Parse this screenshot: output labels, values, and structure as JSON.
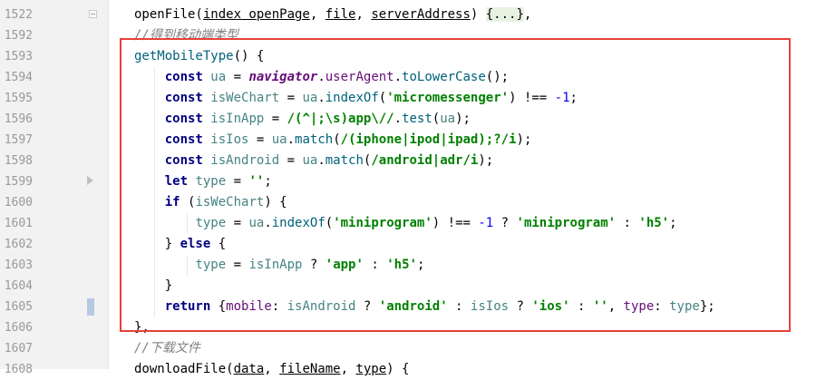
{
  "editor": {
    "lines": [
      {
        "num": "1522",
        "fold": "box",
        "tokens": [
          {
            "t": "openFile(",
            "c": "plain"
          },
          {
            "t": "index openPage",
            "c": "ul"
          },
          {
            "t": ", ",
            "c": "plain"
          },
          {
            "t": "file",
            "c": "ul"
          },
          {
            "t": ", ",
            "c": "plain"
          },
          {
            "t": "serverAddress",
            "c": "ul"
          },
          {
            "t": ") ",
            "c": "plain"
          },
          {
            "t": "{...}",
            "c": "folded"
          },
          {
            "t": ",",
            "c": "plain"
          }
        ]
      },
      {
        "num": "1592",
        "fold": "",
        "tokens": [
          {
            "t": "//得到移动端类型",
            "c": "comment"
          }
        ]
      },
      {
        "num": "1593",
        "fold": "",
        "tokens": [
          {
            "t": "getMobileType",
            "c": "fn"
          },
          {
            "t": "() {",
            "c": "plain"
          }
        ]
      },
      {
        "num": "1594",
        "fold": "",
        "tokens": [
          {
            "t": "    ",
            "c": "plain"
          },
          {
            "t": "const ",
            "c": "kw"
          },
          {
            "t": "ua",
            "c": "ident"
          },
          {
            "t": " = ",
            "c": "plain"
          },
          {
            "t": "navigator",
            "c": "glob"
          },
          {
            "t": ".",
            "c": "plain"
          },
          {
            "t": "userAgent",
            "c": "prop"
          },
          {
            "t": ".",
            "c": "plain"
          },
          {
            "t": "toLowerCase",
            "c": "fn"
          },
          {
            "t": "();",
            "c": "plain"
          }
        ]
      },
      {
        "num": "1595",
        "fold": "",
        "tokens": [
          {
            "t": "    ",
            "c": "plain"
          },
          {
            "t": "const ",
            "c": "kw"
          },
          {
            "t": "isWeChart",
            "c": "ident"
          },
          {
            "t": " = ",
            "c": "plain"
          },
          {
            "t": "ua",
            "c": "ident"
          },
          {
            "t": ".",
            "c": "plain"
          },
          {
            "t": "indexOf",
            "c": "fn"
          },
          {
            "t": "(",
            "c": "plain"
          },
          {
            "t": "'micromessenger'",
            "c": "str"
          },
          {
            "t": ") !== ",
            "c": "plain"
          },
          {
            "t": "-1",
            "c": "num"
          },
          {
            "t": ";",
            "c": "plain"
          }
        ]
      },
      {
        "num": "1596",
        "fold": "",
        "tokens": [
          {
            "t": "    ",
            "c": "plain"
          },
          {
            "t": "const ",
            "c": "kw"
          },
          {
            "t": "isInApp",
            "c": "ident"
          },
          {
            "t": " = ",
            "c": "plain"
          },
          {
            "t": "/(^|;\\s)app\\//",
            "c": "regex"
          },
          {
            "t": ".",
            "c": "plain"
          },
          {
            "t": "test",
            "c": "fn"
          },
          {
            "t": "(",
            "c": "plain"
          },
          {
            "t": "ua",
            "c": "ident"
          },
          {
            "t": ");",
            "c": "plain"
          }
        ]
      },
      {
        "num": "1597",
        "fold": "",
        "tokens": [
          {
            "t": "    ",
            "c": "plain"
          },
          {
            "t": "const ",
            "c": "kw"
          },
          {
            "t": "isIos",
            "c": "ident"
          },
          {
            "t": " = ",
            "c": "plain"
          },
          {
            "t": "ua",
            "c": "ident"
          },
          {
            "t": ".",
            "c": "plain"
          },
          {
            "t": "match",
            "c": "fn"
          },
          {
            "t": "(",
            "c": "plain"
          },
          {
            "t": "/(iphone|ipod|ipad);?/i",
            "c": "regex"
          },
          {
            "t": ");",
            "c": "plain"
          }
        ]
      },
      {
        "num": "1598",
        "fold": "",
        "tokens": [
          {
            "t": "    ",
            "c": "plain"
          },
          {
            "t": "const ",
            "c": "kw"
          },
          {
            "t": "isAndroid",
            "c": "ident"
          },
          {
            "t": " = ",
            "c": "plain"
          },
          {
            "t": "ua",
            "c": "ident"
          },
          {
            "t": ".",
            "c": "plain"
          },
          {
            "t": "match",
            "c": "fn"
          },
          {
            "t": "(",
            "c": "plain"
          },
          {
            "t": "/android|adr/i",
            "c": "regex"
          },
          {
            "t": ");",
            "c": "plain"
          }
        ]
      },
      {
        "num": "1599",
        "fold": "arrow",
        "tokens": [
          {
            "t": "    ",
            "c": "plain"
          },
          {
            "t": "let ",
            "c": "kw"
          },
          {
            "t": "type",
            "c": "ident"
          },
          {
            "t": " = ",
            "c": "plain"
          },
          {
            "t": "''",
            "c": "str"
          },
          {
            "t": ";",
            "c": "plain"
          }
        ]
      },
      {
        "num": "1600",
        "fold": "",
        "tokens": [
          {
            "t": "    ",
            "c": "plain"
          },
          {
            "t": "if ",
            "c": "kw"
          },
          {
            "t": "(",
            "c": "plain"
          },
          {
            "t": "isWeChart",
            "c": "ident"
          },
          {
            "t": ") {",
            "c": "plain"
          }
        ]
      },
      {
        "num": "1601",
        "fold": "",
        "tokens": [
          {
            "t": "        ",
            "c": "plain"
          },
          {
            "t": "type",
            "c": "ident"
          },
          {
            "t": " = ",
            "c": "plain"
          },
          {
            "t": "ua",
            "c": "ident"
          },
          {
            "t": ".",
            "c": "plain"
          },
          {
            "t": "indexOf",
            "c": "fn"
          },
          {
            "t": "(",
            "c": "plain"
          },
          {
            "t": "'miniprogram'",
            "c": "str"
          },
          {
            "t": ") !== ",
            "c": "plain"
          },
          {
            "t": "-1",
            "c": "num"
          },
          {
            "t": " ? ",
            "c": "plain"
          },
          {
            "t": "'miniprogram'",
            "c": "str"
          },
          {
            "t": " : ",
            "c": "plain"
          },
          {
            "t": "'h5'",
            "c": "str"
          },
          {
            "t": ";",
            "c": "plain"
          }
        ]
      },
      {
        "num": "1602",
        "fold": "",
        "tokens": [
          {
            "t": "    } ",
            "c": "plain"
          },
          {
            "t": "else ",
            "c": "kw"
          },
          {
            "t": "{",
            "c": "plain"
          }
        ]
      },
      {
        "num": "1603",
        "fold": "",
        "tokens": [
          {
            "t": "        ",
            "c": "plain"
          },
          {
            "t": "type",
            "c": "ident"
          },
          {
            "t": " = ",
            "c": "plain"
          },
          {
            "t": "isInApp",
            "c": "ident"
          },
          {
            "t": " ? ",
            "c": "plain"
          },
          {
            "t": "'app'",
            "c": "str"
          },
          {
            "t": " : ",
            "c": "plain"
          },
          {
            "t": "'h5'",
            "c": "str"
          },
          {
            "t": ";",
            "c": "plain"
          }
        ]
      },
      {
        "num": "1604",
        "fold": "",
        "tokens": [
          {
            "t": "    }",
            "c": "plain"
          }
        ]
      },
      {
        "num": "1605",
        "fold": "marker",
        "tokens": [
          {
            "t": "    ",
            "c": "plain"
          },
          {
            "t": "return ",
            "c": "kw"
          },
          {
            "t": "{",
            "c": "plain"
          },
          {
            "t": "mobile",
            "c": "prop"
          },
          {
            "t": ": ",
            "c": "plain"
          },
          {
            "t": "isAndroid",
            "c": "ident"
          },
          {
            "t": " ? ",
            "c": "plain"
          },
          {
            "t": "'android'",
            "c": "str"
          },
          {
            "t": " : ",
            "c": "plain"
          },
          {
            "t": "isIos",
            "c": "ident"
          },
          {
            "t": " ? ",
            "c": "plain"
          },
          {
            "t": "'ios'",
            "c": "str"
          },
          {
            "t": " : ",
            "c": "plain"
          },
          {
            "t": "''",
            "c": "str"
          },
          {
            "t": ", ",
            "c": "plain"
          },
          {
            "t": "type",
            "c": "prop"
          },
          {
            "t": ": ",
            "c": "plain"
          },
          {
            "t": "type",
            "c": "ident"
          },
          {
            "t": "};",
            "c": "plain"
          }
        ]
      },
      {
        "num": "1606",
        "fold": "",
        "tokens": [
          {
            "t": "},",
            "c": "plain"
          }
        ]
      },
      {
        "num": "1607",
        "fold": "",
        "tokens": [
          {
            "t": "//下载文件",
            "c": "comment"
          }
        ]
      },
      {
        "num": "1608",
        "fold": "",
        "tokens": [
          {
            "t": "downloadFile(",
            "c": "plain"
          },
          {
            "t": "data",
            "c": "ul"
          },
          {
            "t": ", ",
            "c": "plain"
          },
          {
            "t": "fileName",
            "c": "ul"
          },
          {
            "t": ", ",
            "c": "plain"
          },
          {
            "t": "type",
            "c": "ul"
          },
          {
            "t": ") {",
            "c": "plain"
          }
        ]
      }
    ]
  },
  "colors": {
    "highlight_box": "#e8403a",
    "gutter_bg": "#f2f2f2",
    "keyword": "#000080",
    "string": "#008000",
    "comment": "#808080"
  }
}
